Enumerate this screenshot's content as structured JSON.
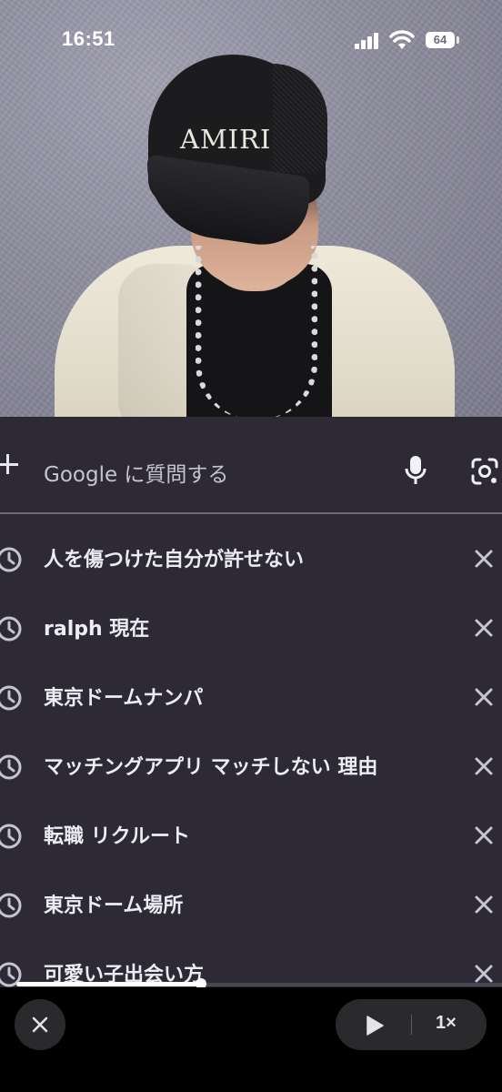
{
  "status_bar": {
    "time": "16:51",
    "battery_level": "64"
  },
  "photo": {
    "cap_logo": "AMIRI"
  },
  "search": {
    "placeholder": "Google に質問する"
  },
  "history": [
    {
      "text": "人を傷つけた自分が許せない"
    },
    {
      "text": "ralph 現在"
    },
    {
      "text": "東京ドームナンパ"
    },
    {
      "text": "マッチングアプリ マッチしない 理由"
    },
    {
      "text": "転職 リクルート"
    },
    {
      "text": "東京ドーム場所"
    },
    {
      "text": "可愛い子出会い方"
    }
  ],
  "player": {
    "progress_fraction": 0.38,
    "speed_label": "1×"
  },
  "colors": {
    "panel_bg": "#2d2a36",
    "text_primary": "#ececf2",
    "icon_gray": "#c7c4d1"
  },
  "icons": {
    "history": "clock-icon",
    "remove": "close-icon",
    "voice": "microphone-icon",
    "image_search": "lens-icon",
    "add": "plus-icon",
    "play": "play-icon"
  }
}
